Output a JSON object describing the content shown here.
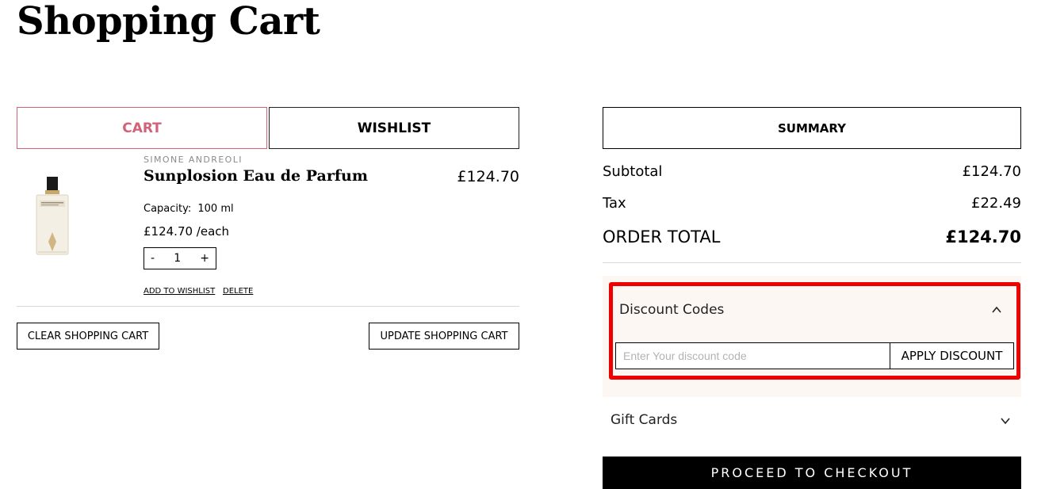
{
  "page": {
    "title": "Shopping Cart"
  },
  "tabs": {
    "cart": "CART",
    "wishlist": "WISHLIST"
  },
  "item": {
    "brand": "SIMONE ANDREOLI",
    "name": "Sunplosion Eau de Parfum",
    "price": "£124.70",
    "capacity_label": "Capacity:",
    "capacity_value": "100 ml",
    "unit_price": "£124.70 /each",
    "quantity": {
      "minus": "-",
      "value": "1",
      "plus": "+"
    },
    "add_to_wishlist": "ADD TO WISHLIST",
    "delete": "DELETE"
  },
  "cart_actions": {
    "clear": "CLEAR SHOPPING CART",
    "update": "UPDATE SHOPPING CART"
  },
  "summary": {
    "heading": "SUMMARY",
    "subtotal_label": "Subtotal",
    "subtotal_value": "£124.70",
    "tax_label": "Tax",
    "tax_value": "£22.49",
    "total_label": "ORDER TOTAL",
    "total_value": "£124.70"
  },
  "discount": {
    "title": "Discount Codes",
    "placeholder": "Enter Your discount code",
    "apply": "APPLY DISCOUNT",
    "highlight_color": "#ee0000"
  },
  "gift_cards": {
    "title": "Gift Cards"
  },
  "checkout": {
    "label": "PROCEED TO CHECKOUT"
  },
  "colors": {
    "accent": "#d4617a",
    "panel": "#fdf7f4"
  }
}
